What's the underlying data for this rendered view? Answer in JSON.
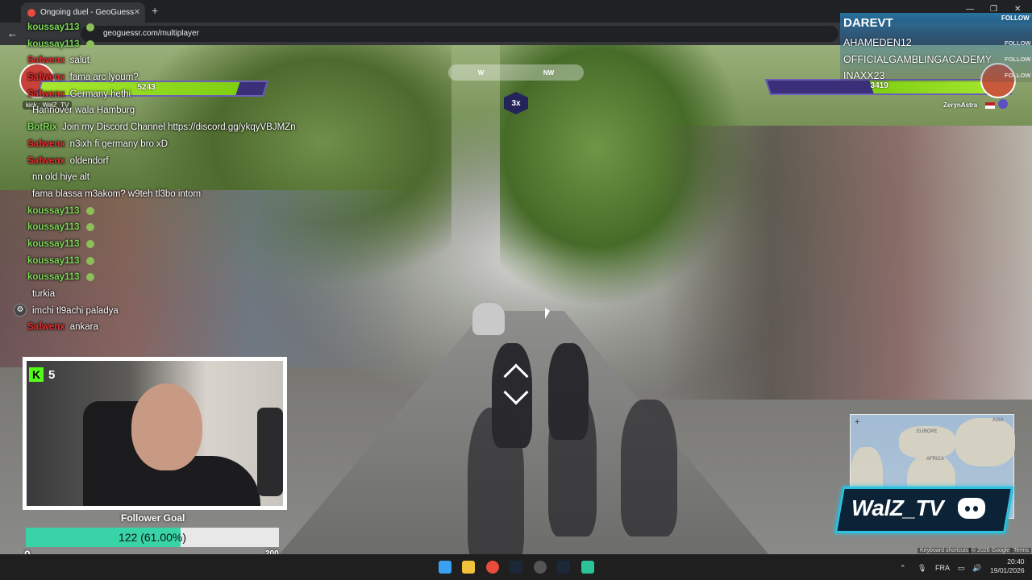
{
  "browser": {
    "tab_title": "Ongoing duel - GeoGuessr",
    "url": "geoguessr.com/multiplayer"
  },
  "game": {
    "compass_letters": [
      "W",
      "NW"
    ],
    "round_multiplier": "3x",
    "player_hp": "5243",
    "opponent_hp": "3419",
    "opponent_name": "ZerynAstra",
    "kick_tag": "kick : WalZ_TV"
  },
  "chat": [
    {
      "user": "koussay113",
      "color": "#7ed957",
      "msg": ""
    },
    {
      "user": "koussay113",
      "color": "#7ed957",
      "msg": ""
    },
    {
      "user": "Safwenx",
      "color": "#e03030",
      "msg": "salut"
    },
    {
      "user": "Safwenx",
      "color": "#e03030",
      "msg": "fama arc lyoum?"
    },
    {
      "user": "Safwenx",
      "color": "#e03030",
      "msg": "Germany hethi"
    },
    {
      "user": "",
      "color": "#e03030",
      "msg": "Hannover wala Hamburg"
    },
    {
      "user": "BotRix",
      "color": "#7ed957",
      "msg": "Join my Discord Channel https://discord.gg/ykqyVBJMZn"
    },
    {
      "user": "Safwenx",
      "color": "#e03030",
      "msg": "n3ixh fi germany bro xD"
    },
    {
      "user": "Safwenx",
      "color": "#e03030",
      "msg": "oldendorf"
    },
    {
      "user": "",
      "color": "#e03030",
      "msg": "nn old hiye alt"
    },
    {
      "user": "",
      "color": "#e03030",
      "msg": "fama blassa m3akom? w9teh tl3bo intom"
    },
    {
      "user": "koussay113",
      "color": "#7ed957",
      "msg": ""
    },
    {
      "user": "koussay113",
      "color": "#7ed957",
      "msg": ""
    },
    {
      "user": "koussay113",
      "color": "#7ed957",
      "msg": ""
    },
    {
      "user": "koussay113",
      "color": "#7ed957",
      "msg": ""
    },
    {
      "user": "koussay113",
      "color": "#7ed957",
      "msg": ""
    },
    {
      "user": "",
      "color": "#e03030",
      "msg": "turkia"
    },
    {
      "user": "",
      "color": "#e03030",
      "msg": "imchi tl9achi paladya"
    },
    {
      "user": "Safwenx",
      "color": "#e03030",
      "msg": "ankara"
    }
  ],
  "webcam": {
    "kick_count": "5",
    "kick_letter": "K"
  },
  "follower_goal": {
    "title": "Follower Goal",
    "progress_text": "122 (61.00%)",
    "progress": 0.61,
    "min": "0",
    "max": "200"
  },
  "followers_panel": {
    "top_name": "DAREVT",
    "top_button": "FOLLOW",
    "rows": [
      {
        "name": "AHAMEDEN12",
        "button": "FOLLOW"
      },
      {
        "name": "OFFICIALGAMBLINGACADEMY",
        "button": "FOLLOW"
      },
      {
        "name": "INAXX23",
        "button": "FOLLOW"
      }
    ]
  },
  "map": {
    "labels": [
      "EUROPE",
      "ASIA",
      "AFRICA"
    ],
    "zoom_in": "+"
  },
  "brand": {
    "name": "WalZ_TV"
  },
  "map_footer": {
    "shortcuts": "Keyboard shortcuts",
    "copyright": "© 2026 Google",
    "terms": "Terms"
  },
  "taskbar": {
    "language": "FRA",
    "time": "20:40",
    "date": "19/01/2026"
  }
}
